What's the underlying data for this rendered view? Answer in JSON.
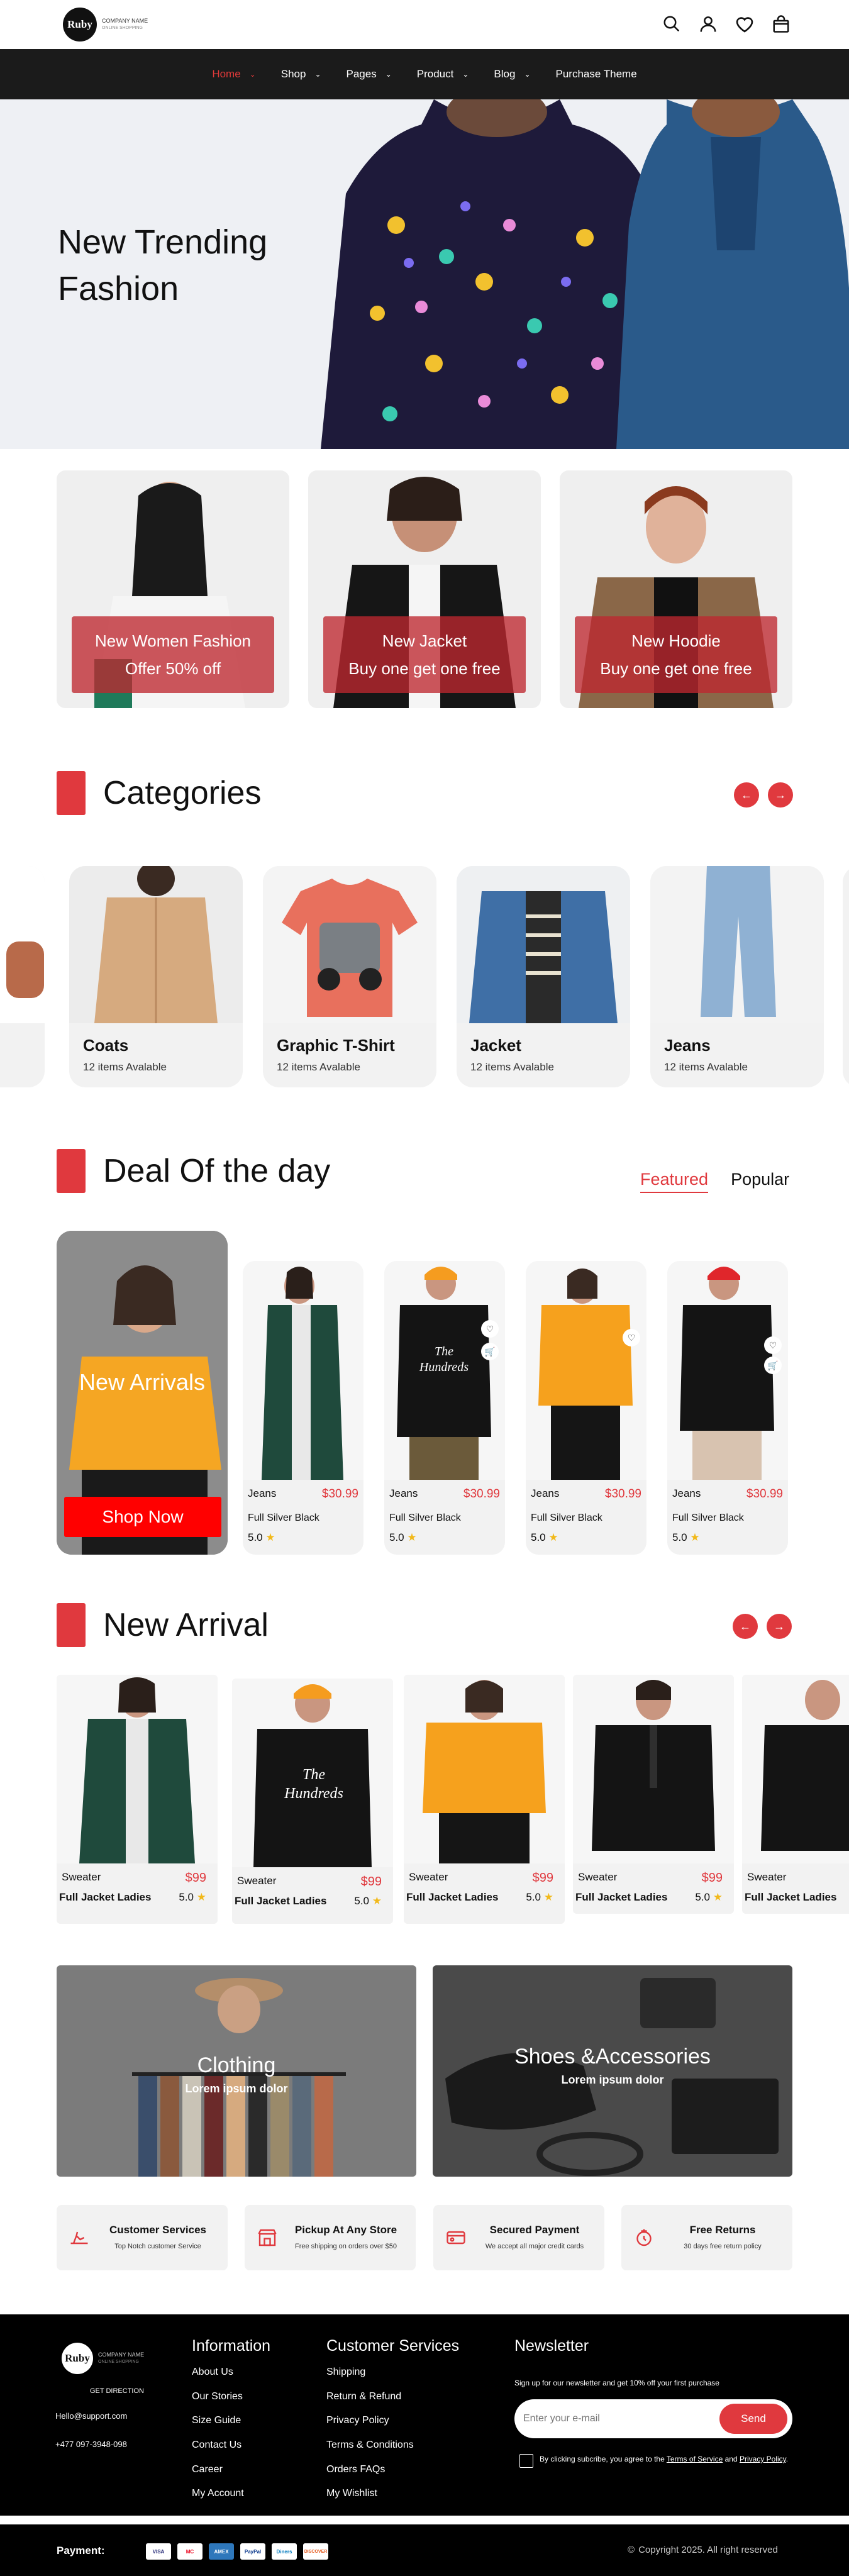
{
  "header": {
    "logo_text": "Ruby",
    "company_name": "COMPANY NAME",
    "company_sub": "ONLINE SHOPPING",
    "icons": [
      "search-icon",
      "user-icon",
      "heart-icon",
      "bag-icon"
    ]
  },
  "nav": {
    "items": [
      {
        "label": "Home",
        "active": true,
        "dropdown": true
      },
      {
        "label": "Shop",
        "dropdown": true
      },
      {
        "label": "Pages",
        "dropdown": true
      },
      {
        "label": "Product",
        "dropdown": true
      },
      {
        "label": "Blog",
        "dropdown": true
      },
      {
        "label": "Purchase Theme",
        "dropdown": false
      }
    ]
  },
  "hero": {
    "line1": "New Trending",
    "line2": "Fashion"
  },
  "promos": [
    {
      "line1": "New Women Fashion",
      "line2": "Offer 50% off"
    },
    {
      "line1": "New Jacket",
      "line2": "Buy one get one free"
    },
    {
      "line1": "New Hoodie",
      "line2": "Buy one get one free"
    }
  ],
  "categories": {
    "title": "Categories",
    "items": [
      {
        "name": "Coats",
        "count": "12 items Avalable"
      },
      {
        "name": "Graphic T-Shirt",
        "count": "12 items Avalable"
      },
      {
        "name": "Jacket",
        "count": "12 items Avalable"
      },
      {
        "name": "Jeans",
        "count": "12 items Avalable"
      }
    ]
  },
  "deals": {
    "title": "Deal Of the day",
    "tab_featured": "Featured",
    "tab_popular": "Popular",
    "arrival_title": "New Arrivals",
    "shop_now": "Shop Now",
    "items": [
      {
        "type": "Jeans",
        "price": "$30.99",
        "name": "Full Silver Black",
        "rating": "5.0"
      },
      {
        "type": "Jeans",
        "price": "$30.99",
        "name": "Full Silver Black",
        "rating": "5.0"
      },
      {
        "type": "Jeans",
        "price": "$30.99",
        "name": "Full Silver Black",
        "rating": "5.0"
      },
      {
        "type": "Jeans",
        "price": "$30.99",
        "name": "Full Silver Black",
        "rating": "5.0"
      }
    ]
  },
  "new_arrival": {
    "title": "New Arrival",
    "items": [
      {
        "type": "Sweater",
        "price": "$99",
        "name": "Full Jacket Ladies",
        "rating": "5.0"
      },
      {
        "type": "Sweater",
        "price": "$99",
        "name": "Full Jacket Ladies",
        "rating": "5.0"
      },
      {
        "type": "Sweater",
        "price": "$99",
        "name": "Full Jacket Ladies",
        "rating": "5.0"
      },
      {
        "type": "Sweater",
        "price": "$99",
        "name": "Full Jacket Ladies",
        "rating": "5.0"
      },
      {
        "type": "Sweater",
        "price": "",
        "name": "Full Jacket Ladies",
        "rating": ""
      }
    ]
  },
  "banners": [
    {
      "title": "Clothing",
      "sub": "Lorem ipsum dolor"
    },
    {
      "title": "Shoes &Accessories",
      "sub": "Lorem ipsum dolor"
    }
  ],
  "services": [
    {
      "title": "Customer Services",
      "desc": "Top Notch customer Service"
    },
    {
      "title": "Pickup At Any Store",
      "desc": "Free shipping on orders over $50"
    },
    {
      "title": "Secured Payment",
      "desc": "We accept all major credit cards"
    },
    {
      "title": "Free Returns",
      "desc": "30 days free return policy"
    }
  ],
  "footer": {
    "logo_text": "Ruby",
    "company_name": "COMPANY NAME",
    "company_sub": "ONLINE SHOPPING",
    "get_direction": "GET DIRECTION",
    "email": "Hello@support.com",
    "phone": "+477 097-3948-098",
    "info_title": "Information",
    "info_links": [
      "About Us",
      "Our Stories",
      "Size Guide",
      "Contact Us",
      "Career",
      "My Account"
    ],
    "cs_title": "Customer Services",
    "cs_links": [
      "Shipping",
      "Return & Refund",
      "Privacy Policy",
      "Terms & Conditions",
      "Orders FAQs",
      "My Wishlist"
    ],
    "nl_title": "Newsletter",
    "nl_desc": "Sign up for our newsletter and get 10% off your first purchase",
    "nl_placeholder": "Enter your e-mail",
    "nl_send": "Send",
    "consent_pre": "By clicking subcribe, you agree to the ",
    "consent_terms": "Terms of Service",
    "consent_and": " and ",
    "consent_privacy": "Privacy Policy",
    "consent_end": "."
  },
  "bottom": {
    "payment_label": "Payment:",
    "cards": [
      "VISA",
      "MC",
      "AMEX",
      "PayPal",
      "Diners",
      "DISCOVER"
    ],
    "copyright": "Copyright 2025. All right reserved"
  },
  "colors": {
    "accent": "#e0393e",
    "dark": "#1b1b1b",
    "card": "#f2f2f2",
    "hero_bg": "#eef0f4"
  }
}
